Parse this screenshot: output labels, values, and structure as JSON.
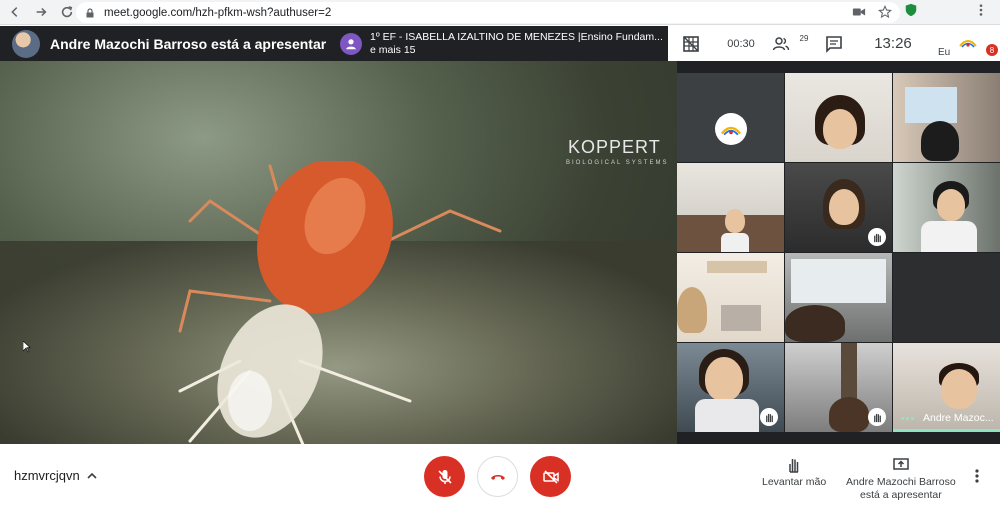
{
  "browser": {
    "url": "meet.google.com/hzh-pfkm-wsh?authuser=2"
  },
  "header": {
    "presenter_banner": "Andre Mazochi Barroso está a apresentar",
    "chat_line1": "1º EF - ISABELLA IZALTINO DE MENEZES |Ensino Fundam...",
    "chat_line2": "e mais 15",
    "elapsed": "00:30",
    "participants_count": "29",
    "clock": "13:26",
    "self_label": "Eu",
    "notification_count": "8"
  },
  "presentation": {
    "brand": "KOPPERT",
    "brand_sub": "BIOLOGICAL SYSTEMS"
  },
  "grid": {
    "presenter_tile_name": "Andre Mazoc..."
  },
  "bottom": {
    "meeting_code": "hzmvrcjqvn",
    "raise_hand_label": "Levantar mão",
    "presenting_line1": "Andre Mazochi Barroso",
    "presenting_line2": "está a apresentar"
  },
  "colors": {
    "accent_red": "#d93025",
    "meet_dark": "#202124",
    "speaking_green": "#8ee5c4"
  }
}
